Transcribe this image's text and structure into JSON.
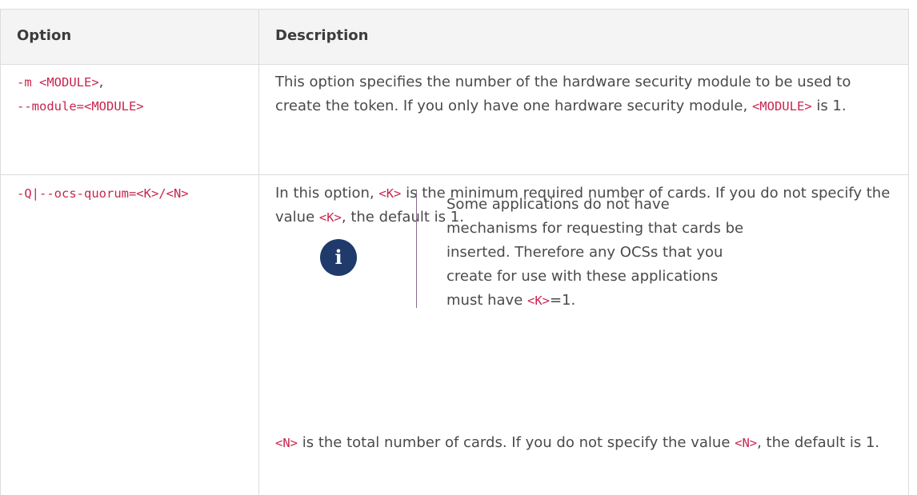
{
  "header": {
    "col1": "Option",
    "col2": "Description"
  },
  "rows": [
    {
      "option_line1": "-m <MODULE>",
      "option_line1_suffix": ",",
      "option_line2": "--module=<MODULE>",
      "desc_text": "This option specifies the number of the hardware security module to be used to create the token. If you only have one hardware security module, ",
      "desc_code": "<MODULE>",
      "desc_tail": " is 1."
    },
    {
      "option_line1": "-Q|--ocs-quorum=<K>/<N>",
      "desc_a": "In this option, ",
      "desc_a_code": "<K>",
      "desc_b": " is the minimum required number of cards. If you do not specify the value ",
      "desc_b_code": "<K>",
      "desc_c": ", the default is 1.",
      "note": {
        "icon": "info-icon",
        "icon_glyph": "i",
        "text": "Some applications do not have mechanisms for requesting that cards be inserted. Therefore any OCSs that you create for use with these applications must have ",
        "code": "<K>",
        "tail": "=1."
      },
      "desc_d_code": "<N>",
      "desc_d": " is the total number of cards. If you do not specify the value ",
      "desc_d_code2": "<N>",
      "desc_d_tail": ", the default is 1."
    }
  ]
}
